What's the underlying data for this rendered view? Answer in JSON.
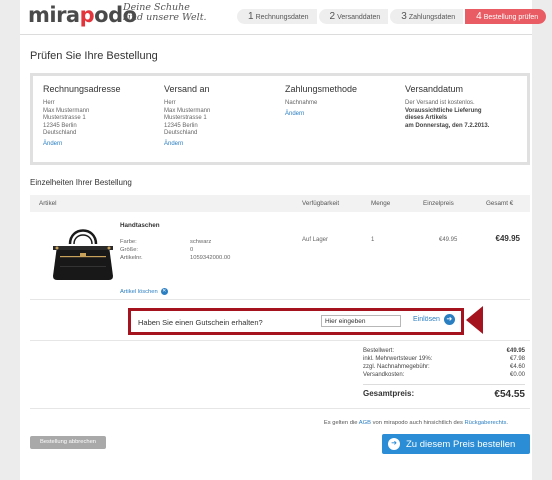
{
  "brand": {
    "logo_main": "mira",
    "logo_accent": "p",
    "logo_rest": "odo",
    "tagline_line1": "Deine Schuhe",
    "tagline_line2": "sind unsere Welt."
  },
  "steps": [
    {
      "num": "1",
      "label": "Rechnungsdaten"
    },
    {
      "num": "2",
      "label": "Versanddaten"
    },
    {
      "num": "3",
      "label": "Zahlungsdaten"
    },
    {
      "num": "4",
      "label": "Bestellung prüfen"
    }
  ],
  "page_title": "Prüfen Sie Ihre Bestellung",
  "summary": {
    "billing": {
      "title": "Rechnungsadresse",
      "lines": [
        "Herr",
        "Max Mustermann",
        "Musterstrasse 1",
        "12345 Berlin",
        "Deutschland"
      ],
      "link": "Ändern"
    },
    "shipping": {
      "title": "Versand an",
      "lines": [
        "Herr",
        "Max Mustermann",
        "Musterstrasse 1",
        "12345 Berlin",
        "Deutschland"
      ],
      "link": "Ändern"
    },
    "payment": {
      "title": "Zahlungsmethode",
      "lines": [
        "Nachnahme"
      ],
      "link": "Ändern"
    },
    "date": {
      "title": "Versanddatum",
      "line1": "Der Versand ist kostenlos.",
      "bold1": "Voraussichtliche Lieferung",
      "bold2": "dieses Artikels",
      "bold3": "am Donnerstag, den 7.2.2013."
    }
  },
  "details_title": "Einzelheiten Ihrer Bestellung",
  "table": {
    "headers": {
      "article": "Artikel",
      "availability": "Verfügbarkeit",
      "quantity": "Menge",
      "unit_price": "Einzelpreis",
      "total": "Gesamt €"
    },
    "item": {
      "name": "Handtaschen",
      "attr_labels": [
        "Farbe:",
        "Größe:",
        "Artikelnr."
      ],
      "attr_values": [
        "schwarz",
        "0",
        "1059342000.00"
      ],
      "availability": "Auf Lager",
      "quantity": "1",
      "unit_price": "€49.95",
      "total": "€49.95",
      "remove_label": "Artikel löschen"
    }
  },
  "voucher": {
    "label": "Haben Sie einen Gutschein erhalten?",
    "value": "Hier eingeben",
    "redeem": "Einlösen"
  },
  "totals": {
    "rows": [
      {
        "label": "Bestellwert:",
        "value": "€49.95"
      },
      {
        "label": "inkl. Mehrwertsteuer 19%:",
        "value": "€7.98"
      },
      {
        "label": "zzgl. Nachnahmegebühr:",
        "value": "€4.60"
      },
      {
        "label": "Versandkosten:",
        "value": "€0.00"
      }
    ],
    "grand_label": "Gesamtpreis:",
    "grand_value": "€54.55"
  },
  "agb": {
    "prefix": "Es gelten die",
    "agb_link": "AGB",
    "middle": "von mirapodo auch hinsichtlich des",
    "return_link": "Rückgaberechts",
    "suffix": "."
  },
  "buttons": {
    "cancel": "Bestellung abbrechen",
    "order": "Zu diesem Preis bestellen"
  }
}
